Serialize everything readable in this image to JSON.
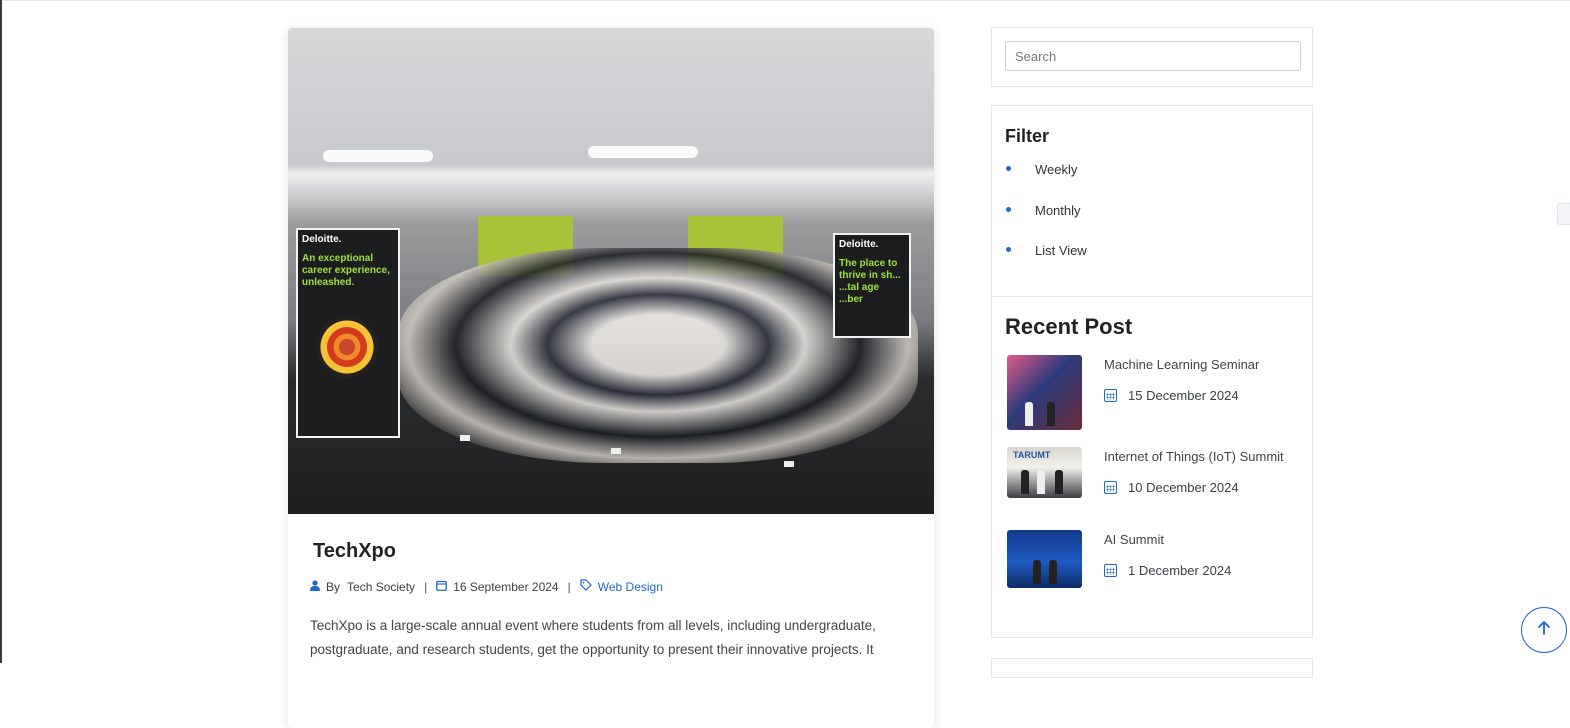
{
  "post": {
    "title": "TechXpo",
    "author_prefix": "By",
    "author": "Tech Society",
    "date": "16 September 2024",
    "category": "Web Design",
    "excerpt": "TechXpo is a large-scale annual event where students from all levels, including undergraduate, postgraduate, and research students, get the opportunity to present their innovative projects. It",
    "image": {
      "banner_left_brand": "Deloitte.",
      "banner_left_tagline": "An exceptional career experience, unleashed.",
      "banner_right_brand": "Deloitte.",
      "banner_right_tagline": "The place to thrive in sh... ...tal age ...ber"
    }
  },
  "sidebar": {
    "search": {
      "placeholder": "Search"
    },
    "filter": {
      "title": "Filter",
      "items": [
        {
          "label": "Weekly"
        },
        {
          "label": "Monthly"
        },
        {
          "label": "List View"
        }
      ]
    },
    "recent": {
      "title": "Recent Post",
      "items": [
        {
          "title": "Machine Learning Seminar",
          "date": "15 December 2024"
        },
        {
          "title": "Internet of Things (IoT) Summit",
          "date": "10 December 2024",
          "thumb_text": "TARUMT"
        },
        {
          "title": "AI Summit",
          "date": "1 December 2024"
        }
      ]
    }
  },
  "colors": {
    "accent": "#1f67c9",
    "text": "#212529",
    "border": "#e6e6e6"
  },
  "icons": {
    "author": "user-icon",
    "date": "calendar-icon",
    "category": "tag-icon",
    "scroll_top": "arrow-up-icon"
  }
}
